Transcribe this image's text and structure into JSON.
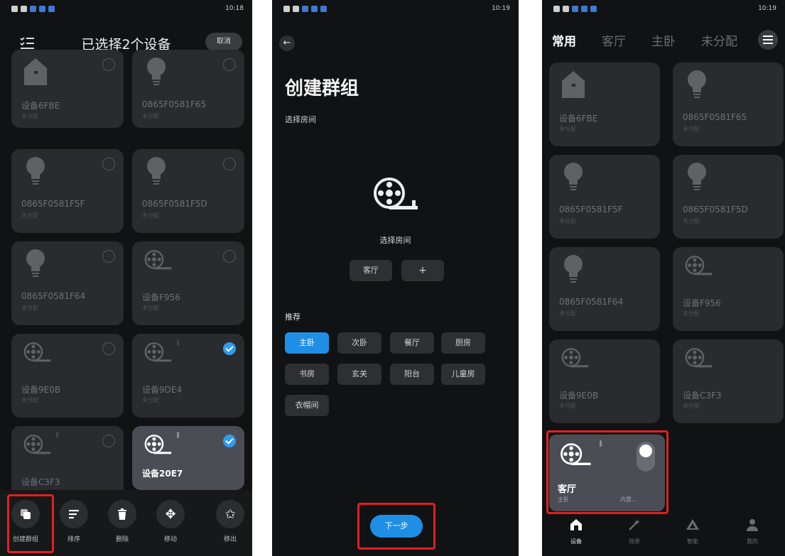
{
  "status": {
    "time_p1": "10:18",
    "time_p2": "10:19",
    "time_p3": "10:19"
  },
  "panel1": {
    "title": "已选择2个设备",
    "cancel_label": "取消",
    "devices": [
      {
        "name": "设备6FBE",
        "room": "未分配",
        "icon": "home-device-icon",
        "checked": false
      },
      {
        "name": "0865F0581F65",
        "room": "未分配",
        "icon": "bulb-icon",
        "checked": false
      },
      {
        "name": "0865F0581F5F",
        "room": "未分配",
        "icon": "bulb-icon",
        "checked": false
      },
      {
        "name": "0865F0581F5D",
        "room": "未分配",
        "icon": "bulb-icon",
        "checked": false
      },
      {
        "name": "0865F0581F64",
        "room": "未分配",
        "icon": "bulb-icon",
        "checked": false
      },
      {
        "name": "设备F956",
        "room": "未分配",
        "icon": "film-reel-icon",
        "checked": false
      },
      {
        "name": "设备9E0B",
        "room": "未分配",
        "icon": "film-reel-icon",
        "checked": false
      },
      {
        "name": "设备9DE4",
        "room": "未分配",
        "icon": "film-reel-icon",
        "checked": true
      },
      {
        "name": "设备C3F3",
        "room": "未分配",
        "icon": "film-reel-icon",
        "checked": false
      },
      {
        "name": "设备20E7",
        "room": "",
        "icon": "film-reel-icon",
        "checked": true
      }
    ],
    "toolbar": [
      {
        "label": "创建群组",
        "icon": "group-icon"
      },
      {
        "label": "排序",
        "icon": "sort-icon"
      },
      {
        "label": "删除",
        "icon": "trash-icon"
      },
      {
        "label": "移动",
        "icon": "move-icon"
      },
      {
        "label": "移出",
        "icon": "remove-icon"
      }
    ]
  },
  "panel2": {
    "title": "创建群组",
    "subtitle": "选择房间",
    "room_label": "选择房间",
    "selected_room": "客厅",
    "add_symbol": "+",
    "recommend_label": "推荐",
    "recommend": [
      "主卧",
      "次卧",
      "餐厅",
      "厨房",
      "书房",
      "玄关",
      "阳台",
      "儿童房",
      "衣帽间"
    ],
    "active_recommend": "主卧",
    "next_label": "下一步"
  },
  "panel3": {
    "tabs": [
      "常用",
      "客厅",
      "主卧",
      "未分配"
    ],
    "active_tab": "常用",
    "devices": [
      {
        "name": "设备6FBE",
        "room": "未分配",
        "icon": "home-device-icon"
      },
      {
        "name": "0865F0581F65",
        "room": "未分配",
        "icon": "bulb-icon"
      },
      {
        "name": "0865F0581F5F",
        "room": "未分配",
        "icon": "bulb-icon"
      },
      {
        "name": "0865F0581F5D",
        "room": "未分配",
        "icon": "bulb-icon"
      },
      {
        "name": "0865F0581F64",
        "room": "未分配",
        "icon": "bulb-icon"
      },
      {
        "name": "设备F956",
        "room": "未分配",
        "icon": "film-reel-icon"
      },
      {
        "name": "设备9E0B",
        "room": "未分配",
        "icon": "film-reel-icon"
      },
      {
        "name": "设备C3F3",
        "room": "未分配",
        "icon": "film-reel-icon"
      }
    ],
    "group_card": {
      "name": "客厅",
      "room": "主卧",
      "builtin": "内置…"
    },
    "nav": [
      "设备",
      "场景",
      "智能",
      "我的"
    ]
  },
  "colors": {
    "accent": "#1f8fe6",
    "highlight_box": "#e02020",
    "background": "#111214",
    "card": "#2a2b2e"
  }
}
